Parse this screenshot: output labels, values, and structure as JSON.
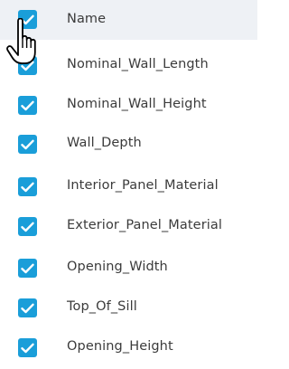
{
  "header": {
    "label": "Name",
    "checked": true
  },
  "items": [
    {
      "label": "Nominal_Wall_Length",
      "checked": true
    },
    {
      "label": "Nominal_Wall_Height",
      "checked": true
    },
    {
      "label": "Wall_Depth",
      "checked": true
    },
    {
      "label": "Interior_Panel_Material",
      "checked": true
    },
    {
      "label": "Exterior_Panel_Material",
      "checked": true
    },
    {
      "label": "Opening_Width",
      "checked": true
    },
    {
      "label": "Top_Of_Sill",
      "checked": true
    },
    {
      "label": "Opening_Height",
      "checked": true
    }
  ],
  "colors": {
    "checkbox": "#1a9ed9",
    "header_bg": "#eef1f5",
    "text": "#3b3b3b"
  },
  "icons": {
    "checkmark": "checkmark-icon",
    "cursor": "hand-pointer-cursor-icon"
  }
}
